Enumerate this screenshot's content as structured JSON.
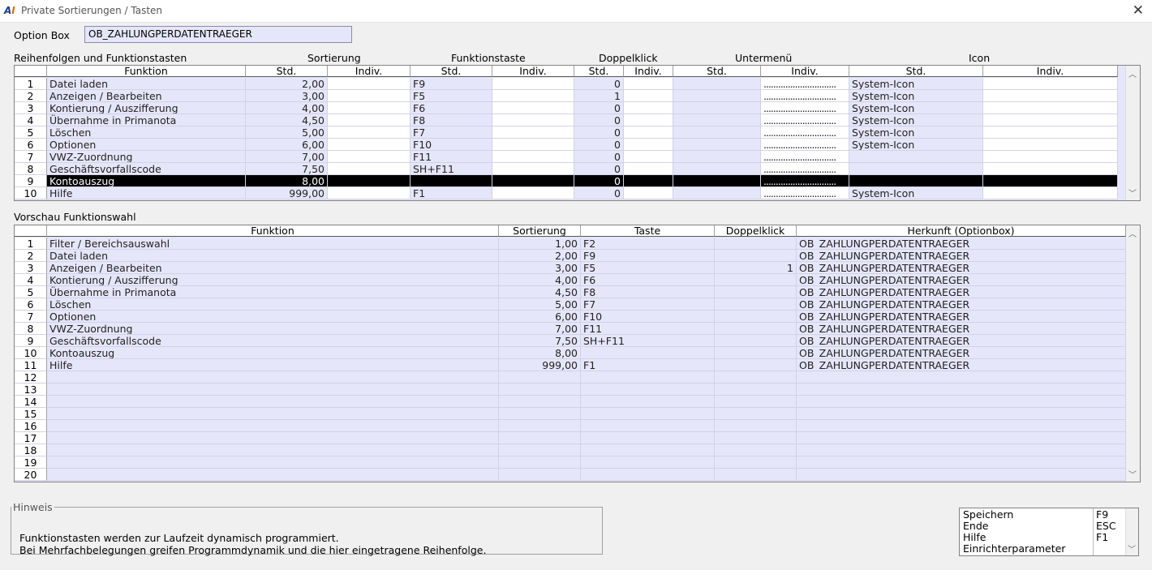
{
  "window": {
    "title": "Private Sortierungen / Tasten",
    "logo_a": "A",
    "logo_b": "I",
    "close_glyph": "✕"
  },
  "optionbox": {
    "label": "Option Box",
    "value": "OB_ZAHLUNGPERDATENTRAEGER"
  },
  "grid1": {
    "section_label": "Reihenfolgen und Funktionstasten",
    "groups": {
      "sortierung": "Sortierung",
      "funktionstaste": "Funktionstaste",
      "doppelklick": "Doppelklick",
      "untermenue": "Untermenü",
      "icon": "Icon"
    },
    "headers": [
      "",
      "Funktion",
      "Std.",
      "Indiv.",
      "Std.",
      "Indiv.",
      "Std.",
      "Indiv.",
      "Std.",
      "Indiv.",
      "Std.",
      "Indiv."
    ],
    "rows": [
      [
        "1",
        "Datei laden",
        "2,00",
        "",
        "F9",
        "",
        "0",
        "",
        "",
        "..............................",
        "System-Icon",
        ""
      ],
      [
        "2",
        "Anzeigen / Bearbeiten",
        "3,00",
        "",
        "F5",
        "",
        "1",
        "",
        "",
        "..............................",
        "System-Icon",
        ""
      ],
      [
        "3",
        "Kontierung / Auszifferung",
        "4,00",
        "",
        "F6",
        "",
        "0",
        "",
        "",
        "..............................",
        "System-Icon",
        ""
      ],
      [
        "4",
        "Übernahme in Primanota",
        "4,50",
        "",
        "F8",
        "",
        "0",
        "",
        "",
        "..............................",
        "System-Icon",
        ""
      ],
      [
        "5",
        "Löschen",
        "5,00",
        "",
        "F7",
        "",
        "0",
        "",
        "",
        "..............................",
        "System-Icon",
        ""
      ],
      [
        "6",
        "Optionen",
        "6,00",
        "",
        "F10",
        "",
        "0",
        "",
        "",
        "..............................",
        "System-Icon",
        ""
      ],
      [
        "7",
        "VWZ-Zuordnung",
        "7,00",
        "",
        "F11",
        "",
        "0",
        "",
        "",
        "..............................",
        "",
        ""
      ],
      [
        "8",
        "Geschäftsvorfallscode",
        "7,50",
        "",
        "SH+F11",
        "",
        "0",
        "",
        "",
        "..............................",
        "",
        ""
      ],
      [
        "9",
        "Kontoauszug",
        "8,00",
        "",
        "",
        "",
        "0",
        "",
        "",
        "..............................",
        "",
        ""
      ],
      [
        "10",
        "Hilfe",
        "999,00",
        "",
        "F1",
        "",
        "0",
        "",
        "",
        "..............................",
        "System-Icon",
        ""
      ]
    ],
    "selected_row": 8
  },
  "grid2": {
    "section_label": "Vorschau Funktionswahl",
    "headers": [
      "",
      "Funktion",
      "Sortierung",
      "Taste",
      "Doppelklick",
      "Herkunft (Optionbox)"
    ],
    "rows": [
      [
        "1",
        "Filter / Bereichsauswahl",
        "1,00",
        "F2",
        "",
        "OB_ZAHLUNGPERDATENTRAEGER"
      ],
      [
        "2",
        "Datei laden",
        "2,00",
        "F9",
        "",
        "OB_ZAHLUNGPERDATENTRAEGER"
      ],
      [
        "3",
        "Anzeigen / Bearbeiten",
        "3,00",
        "F5",
        "1",
        "OB_ZAHLUNGPERDATENTRAEGER"
      ],
      [
        "4",
        "Kontierung / Auszifferung",
        "4,00",
        "F6",
        "",
        "OB_ZAHLUNGPERDATENTRAEGER"
      ],
      [
        "5",
        "Übernahme in Primanota",
        "4,50",
        "F8",
        "",
        "OB_ZAHLUNGPERDATENTRAEGER"
      ],
      [
        "6",
        "Löschen",
        "5,00",
        "F7",
        "",
        "OB_ZAHLUNGPERDATENTRAEGER"
      ],
      [
        "7",
        "Optionen",
        "6,00",
        "F10",
        "",
        "OB_ZAHLUNGPERDATENTRAEGER"
      ],
      [
        "8",
        "VWZ-Zuordnung",
        "7,00",
        "F11",
        "",
        "OB_ZAHLUNGPERDATENTRAEGER"
      ],
      [
        "9",
        "Geschäftsvorfallscode",
        "7,50",
        "SH+F11",
        "",
        "OB_ZAHLUNGPERDATENTRAEGER"
      ],
      [
        "10",
        "Kontoauszug",
        "8,00",
        "",
        "",
        "OB_ZAHLUNGPERDATENTRAEGER"
      ],
      [
        "11",
        "Hilfe",
        "999,00",
        "F1",
        "",
        "OB_ZAHLUNGPERDATENTRAEGER"
      ],
      [
        "12",
        "",
        "",
        "",
        "",
        ""
      ],
      [
        "13",
        "",
        "",
        "",
        "",
        ""
      ],
      [
        "14",
        "",
        "",
        "",
        "",
        ""
      ],
      [
        "15",
        "",
        "",
        "",
        "",
        ""
      ],
      [
        "16",
        "",
        "",
        "",
        "",
        ""
      ],
      [
        "17",
        "",
        "",
        "",
        "",
        ""
      ],
      [
        "18",
        "",
        "",
        "",
        "",
        ""
      ],
      [
        "19",
        "",
        "",
        "",
        "",
        ""
      ],
      [
        "20",
        "",
        "",
        "",
        "",
        ""
      ]
    ]
  },
  "hint": {
    "legend": "Hinweis",
    "line1": "Funktionstasten werden zur Laufzeit dynamisch programmiert.",
    "line2": "Bei Mehrfachbelegungen greifen Programmdynamik und die hier eingetragene Reihenfolge."
  },
  "keys": [
    {
      "label": "Speichern",
      "key": "F9"
    },
    {
      "label": "Ende",
      "key": "ESC"
    },
    {
      "label": "Hilfe",
      "key": "F1"
    },
    {
      "label": "Einrichterparameter",
      "key": ""
    }
  ],
  "scroll": {
    "up": "︿",
    "down": "﹀"
  }
}
